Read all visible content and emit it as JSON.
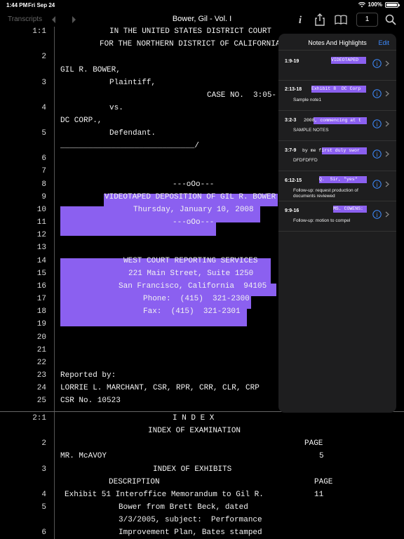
{
  "status": {
    "time": "1:44 PM",
    "date": "Fri Sep 24",
    "battery": "100%",
    "battery_level": 1.0
  },
  "nav": {
    "back_label": "Transcripts",
    "title": "Bower, Gil - Vol. I",
    "page_number": "1"
  },
  "transcript": {
    "page1_label": "1:1",
    "page2_label": "2:1",
    "lines": [
      {
        "n": "",
        "t": "IN THE UNITED STATES DISTRICT COURT"
      },
      {
        "n": "",
        "t": "FOR THE NORTHERN DISTRICT OF CALIFORNIA"
      },
      {
        "n": "2",
        "t": ""
      },
      {
        "n": "",
        "t": "GIL R. BOWER,"
      },
      {
        "n": "3",
        "t": "Plaintiff,"
      },
      {
        "n": "",
        "t": "CASE NO.  3:05-"
      },
      {
        "n": "4",
        "t": "vs."
      },
      {
        "n": "",
        "t": "DC CORP.,"
      },
      {
        "n": "5",
        "t": "Defendant."
      },
      {
        "n": "",
        "t": "_____________________________/"
      },
      {
        "n": "6",
        "t": ""
      },
      {
        "n": "7",
        "t": ""
      },
      {
        "n": "8",
        "t": "---oOo---"
      },
      {
        "n": "9",
        "t": "VIDEOTAPED DEPOSITION OF GIL R. BOWER"
      },
      {
        "n": "10",
        "t": "Thursday, January 10, 2008"
      },
      {
        "n": "11",
        "t": "---oOo---"
      },
      {
        "n": "12",
        "t": ""
      },
      {
        "n": "13",
        "t": ""
      },
      {
        "n": "14",
        "t": "WEST COURT REPORTING SERVICES"
      },
      {
        "n": "15",
        "t": "221 Main Street, Suite 1250"
      },
      {
        "n": "16",
        "t": "San Francisco, California  94105"
      },
      {
        "n": "17",
        "t": "Phone:  (415)  321-2300"
      },
      {
        "n": "18",
        "t": "Fax:  (415)  321-2301"
      },
      {
        "n": "19",
        "t": ""
      },
      {
        "n": "20",
        "t": ""
      },
      {
        "n": "21",
        "t": ""
      },
      {
        "n": "22",
        "t": ""
      },
      {
        "n": "23",
        "t": "Reported by:"
      },
      {
        "n": "24",
        "t": "LORRIE L. MARCHANT, CSR, RPR, CRR, CLR, CRP"
      },
      {
        "n": "25",
        "t": "CSR No. 10523"
      }
    ],
    "page2_lines": [
      {
        "n": "",
        "t": "I N D E X"
      },
      {
        "n": "",
        "t": "INDEX OF EXAMINATION"
      },
      {
        "n": "2",
        "t": "PAGE"
      },
      {
        "n": "",
        "t": "MR. McAVOY"
      },
      {
        "n": "",
        "t": "5"
      },
      {
        "n": "3",
        "t": "INDEX OF EXHIBITS"
      },
      {
        "n": "",
        "t": "DESCRIPTION"
      },
      {
        "n": "",
        "t": "PAGE"
      },
      {
        "n": "4",
        "t": "Exhibit 51 Interoffice Memorandum to Gil R."
      },
      {
        "n": "",
        "t": "11"
      },
      {
        "n": "5",
        "t": "Bower from Brett Beck, dated"
      },
      {
        "n": "",
        "t": "3/3/2005, subject:  Performance"
      },
      {
        "n": "6",
        "t": "Improvement Plan, Bates stamped"
      }
    ]
  },
  "panel": {
    "title": "Notes And Highlights",
    "edit_label": "Edit",
    "notes": [
      {
        "ref": "1:9-19",
        "snippet": "VIDEOTAPED",
        "note": ""
      },
      {
        "ref": "2:13-18",
        "snippet": "Exhibit 8  DC Corp",
        "note": "Sample note1"
      },
      {
        "ref": "3:2-3",
        "snippet": "2008, commencing at t",
        "note": "SAMPLE NOTES"
      },
      {
        "ref": "3:7-9",
        "snippet": "by me first duly swor",
        "note": "DFDFDFFD"
      },
      {
        "ref": "6:12-15",
        "snippet": "Q.  Sir, \"yes\"",
        "note": "Follow-up:  request production of documents reviewed"
      },
      {
        "ref": "9:9-16",
        "snippet": "MS. COWENS:",
        "note": "Follow-up:  motion to compel"
      }
    ]
  },
  "colors": {
    "highlight": "#8b60f0",
    "accent": "#3d8bff",
    "background": "#000000",
    "panel": "#1e1e1f"
  },
  "icons": [
    "back-arrow-icon",
    "forward-arrow-icon",
    "info-icon",
    "share-icon",
    "book-icon",
    "search-icon",
    "wifi-icon",
    "battery-icon",
    "chevron-right-icon"
  ]
}
